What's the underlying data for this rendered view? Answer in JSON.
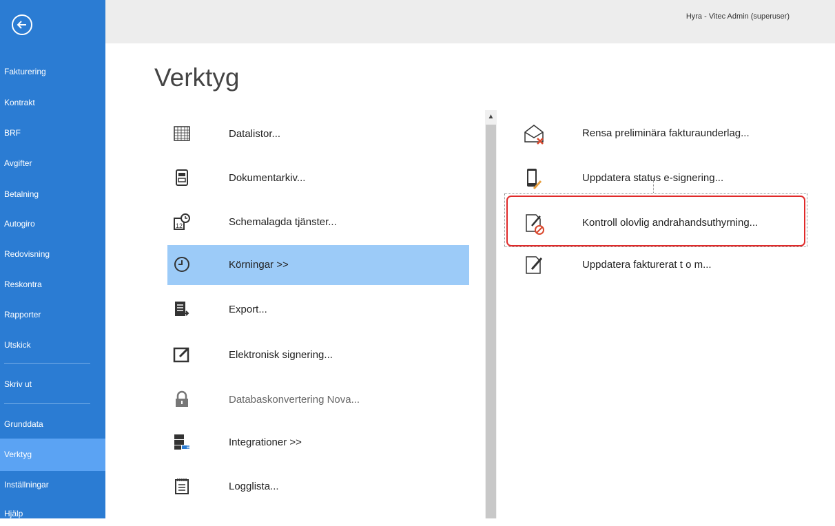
{
  "header": {
    "user_label": "Hyra - Vitec Admin (superuser)"
  },
  "page": {
    "title": "Verktyg"
  },
  "sidebar": {
    "items": [
      {
        "label": "Fakturering"
      },
      {
        "label": "Kontrakt"
      },
      {
        "label": "BRF"
      },
      {
        "label": "Avgifter"
      },
      {
        "label": "Betalning"
      },
      {
        "label": "Autogiro"
      },
      {
        "label": "Redovisning"
      },
      {
        "label": "Reskontra"
      },
      {
        "label": "Rapporter"
      },
      {
        "label": "Utskick"
      },
      {
        "label": "Skriv ut"
      },
      {
        "label": "Grunddata"
      },
      {
        "label": "Verktyg",
        "active": true
      },
      {
        "label": "Inställningar"
      },
      {
        "label": "Hjälp"
      }
    ]
  },
  "tools": {
    "items": [
      {
        "label": "Datalistor...",
        "icon": "grid-icon"
      },
      {
        "label": "Dokumentarkiv...",
        "icon": "cabinet-icon"
      },
      {
        "label": "Schemalagda tjänster...",
        "icon": "calendar-clock-icon"
      },
      {
        "label": "Körningar >>",
        "icon": "clock-icon",
        "active": true
      },
      {
        "label": "Export...",
        "icon": "export-icon"
      },
      {
        "label": "Elektronisk signering...",
        "icon": "sign-icon"
      },
      {
        "label": "Databaskonvertering Nova...",
        "icon": "lock-icon",
        "disabled": true
      },
      {
        "label": "Integrationer >>",
        "icon": "server-plug-icon"
      },
      {
        "label": "Logglista...",
        "icon": "notepad-icon"
      }
    ]
  },
  "runs": {
    "items": [
      {
        "label": "Rensa preliminära fakturaunderlag...",
        "icon": "envelope-delete-icon"
      },
      {
        "label": "Uppdatera status e-signering...",
        "icon": "phone-pen-icon"
      },
      {
        "label": "Kontroll olovlig andrahandsuthyrning...",
        "icon": "document-block-icon"
      },
      {
        "label": "Uppdatera fakturerat t o m...",
        "icon": "document-pen-icon"
      }
    ]
  },
  "colors": {
    "sidebar": "#2b7cd3",
    "sidebar_active": "#5ba3f3",
    "item_active": "#9ccbf8",
    "highlight": "#e02a2a"
  }
}
